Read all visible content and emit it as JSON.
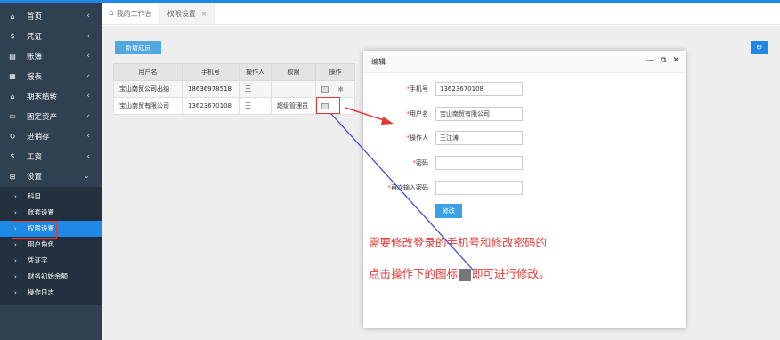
{
  "sidebar": {
    "items": [
      {
        "label": "首页",
        "icon": "home-icon",
        "glyph": "⌂"
      },
      {
        "label": "凭证",
        "icon": "dollar-icon",
        "glyph": "$"
      },
      {
        "label": "账簿",
        "icon": "book-icon",
        "glyph": "▤"
      },
      {
        "label": "报表",
        "icon": "report-icon",
        "glyph": "▦"
      },
      {
        "label": "期末结转",
        "icon": "home-icon",
        "glyph": "⌂"
      },
      {
        "label": "固定资产",
        "icon": "monitor-icon",
        "glyph": "▭"
      },
      {
        "label": "进销存",
        "icon": "refresh-icon",
        "glyph": "↻"
      },
      {
        "label": "工资",
        "icon": "dollar-icon",
        "glyph": "$"
      },
      {
        "label": "设置",
        "icon": "grid-icon",
        "glyph": "⊞"
      }
    ],
    "subitems": [
      "科目",
      "账套设置",
      "权限设置",
      "用户角色",
      "凭证字",
      "财务初始余额",
      "操作日志"
    ]
  },
  "tabs": {
    "home": "我的工作台",
    "current": "权限设置",
    "close": "×"
  },
  "toolbar": {
    "add_label": "新增成员",
    "refresh_glyph": "↻"
  },
  "table": {
    "headers": [
      "用户名",
      "手机号",
      "操作人",
      "权限",
      "操作"
    ],
    "rows": [
      {
        "username": "宝山南贸公司出纳",
        "phone": "18636978518",
        "operator": "王",
        "role": ""
      },
      {
        "username": "宝山南贸有限公司",
        "phone": "13623670108",
        "operator": "王",
        "role": "超级管理员"
      }
    ]
  },
  "modal": {
    "title": "编辑",
    "fields": [
      {
        "label": "手机号",
        "value": "13623670108"
      },
      {
        "label": "用户名",
        "value": "宝山南贸有限公司"
      },
      {
        "label": "操作人",
        "value": "王江涛"
      },
      {
        "label": "密码",
        "value": ""
      },
      {
        "label": "再次输入密码",
        "value": ""
      }
    ],
    "save_label": "修改",
    "ctrl_min": "—",
    "ctrl_max": "⧉",
    "ctrl_close": "✕"
  },
  "annotation": {
    "line1": "需要修改登录的手机号和修改密码的",
    "line2_before": "点击操作下的图标",
    "line2_after": "即可进行修改。"
  },
  "colors": {
    "sidebar_bg": "#2f4050",
    "accent": "#1e88e5",
    "annotation_red": "#e53935",
    "connector_blue": "#3b4bd4"
  }
}
